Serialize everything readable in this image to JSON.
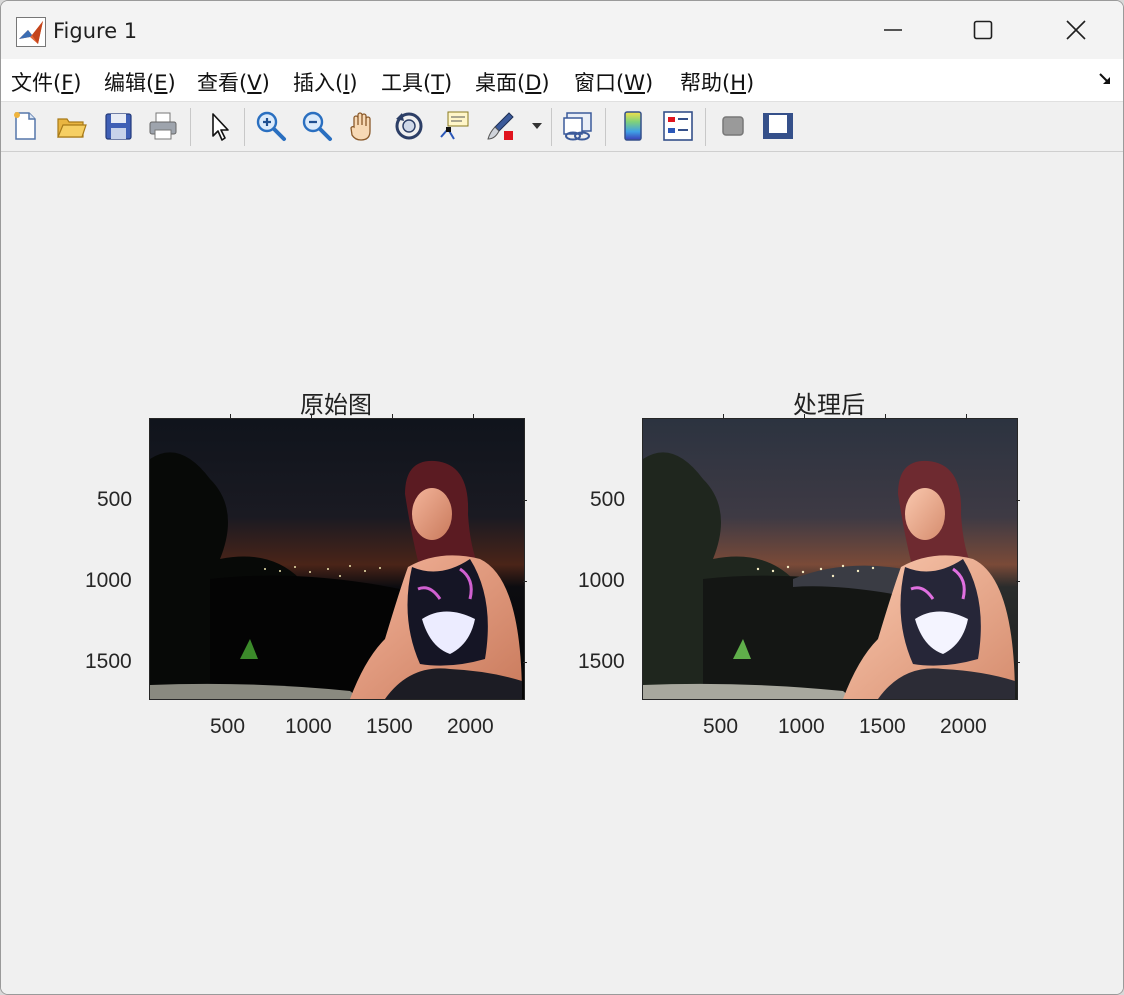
{
  "window": {
    "title": "Figure 1"
  },
  "menubar": {
    "items": [
      {
        "label": "文件(",
        "acc": "F",
        "end": ")"
      },
      {
        "label": "编辑(",
        "acc": "E",
        "end": ")"
      },
      {
        "label": "查看(",
        "acc": "V",
        "end": ")"
      },
      {
        "label": "插入(",
        "acc": "I",
        "end": ")"
      },
      {
        "label": "工具(",
        "acc": "T",
        "end": ")"
      },
      {
        "label": "桌面(",
        "acc": "D",
        "end": ")"
      },
      {
        "label": "窗口(",
        "acc": "W",
        "end": ")"
      },
      {
        "label": "帮助(",
        "acc": "H",
        "end": ")"
      }
    ]
  },
  "toolbar": {
    "icons": [
      "new-figure-icon",
      "open-file-icon",
      "save-icon",
      "print-icon",
      "edit-plot-icon",
      "zoom-in-icon",
      "zoom-out-icon",
      "pan-icon",
      "rotate-3d-icon",
      "data-cursor-icon",
      "brush-icon",
      "link-plot-icon",
      "colorbar-icon",
      "legend-icon",
      "hide-plot-tools-icon",
      "show-plot-tools-icon"
    ]
  },
  "figure": {
    "axes": [
      {
        "title": "原始图",
        "xticks": [
          "500",
          "1000",
          "1500",
          "2000"
        ],
        "yticks": [
          "500",
          "1000",
          "1500"
        ],
        "image": "dark night photo of woman sitting over city lights"
      },
      {
        "title": "处理后",
        "xticks": [
          "500",
          "1000",
          "1500",
          "2000"
        ],
        "yticks": [
          "500",
          "1000",
          "1500"
        ],
        "image": "brightened night photo of woman sitting over city lights"
      }
    ]
  },
  "colors": {
    "accent": "#0060c0",
    "background": "#f0f0f0"
  }
}
